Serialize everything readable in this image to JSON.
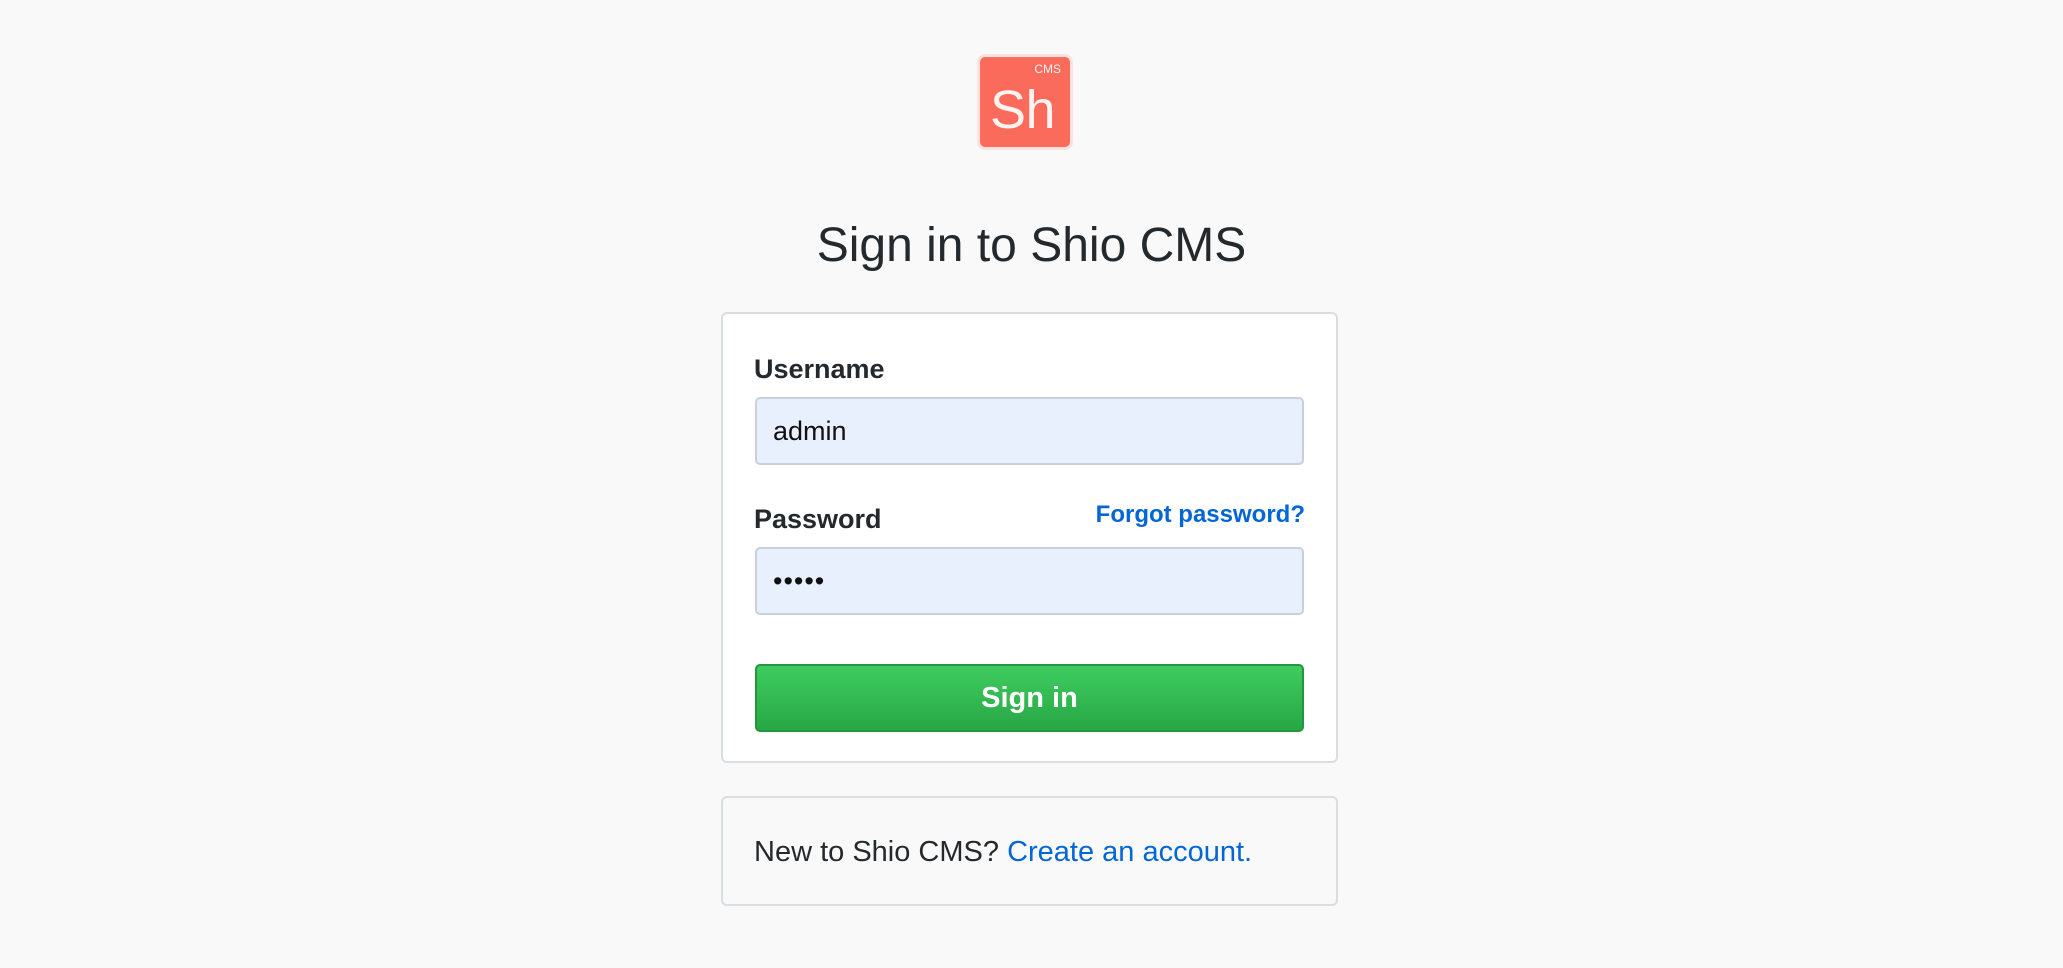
{
  "logo": {
    "mark": "Sh",
    "tag": "CMS",
    "color": "#fb6b5b"
  },
  "title": "Sign in to Shio CMS",
  "form": {
    "username_label": "Username",
    "username_value": "admin",
    "password_label": "Password",
    "password_value": "admin",
    "forgot_link": "Forgot password?",
    "submit_label": "Sign in"
  },
  "create": {
    "prompt": "New to Shio CMS?",
    "link": "Create an account."
  },
  "colors": {
    "background": "#f9f9f9",
    "accent_link": "#0366d6",
    "button_green": "#28a745",
    "input_fill": "#e8f0fe"
  }
}
